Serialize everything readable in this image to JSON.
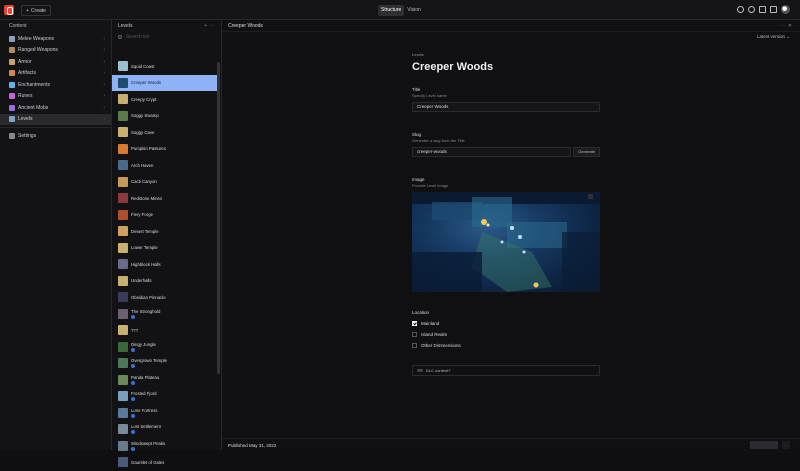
{
  "topbar": {
    "create_label": "Create",
    "tabs": [
      "Structure",
      "Vision"
    ],
    "active_tab": 0
  },
  "nav": {
    "title": "Content",
    "items": [
      {
        "label": "Melee Weapons",
        "icon": "sword-icon",
        "color": "#8fa0b3"
      },
      {
        "label": "Ranged Weapons",
        "icon": "bow-icon",
        "color": "#b38b5a"
      },
      {
        "label": "Armor",
        "icon": "armor-icon",
        "color": "#c9a36b"
      },
      {
        "label": "Artifacts",
        "icon": "artifact-icon",
        "color": "#d88a3a"
      },
      {
        "label": "Enchantments",
        "icon": "enchantment-icon",
        "color": "#5fb3e6"
      },
      {
        "label": "Runes",
        "icon": "rune-icon",
        "color": "#c85fd6"
      },
      {
        "label": "Ancient Mobs",
        "icon": "mob-icon",
        "color": "#9b6be0"
      },
      {
        "label": "Levels",
        "icon": "map-icon",
        "color": "#7fa5c4"
      }
    ],
    "settings_label": "Settings"
  },
  "levels": {
    "title": "Levels",
    "search_placeholder": "Search list",
    "items": [
      {
        "label": "Squid Coast",
        "color": "#9bbfd0",
        "dlc": false
      },
      {
        "label": "Creeper Woods",
        "color": "#1e4a6e",
        "dlc": false
      },
      {
        "label": "Creepy Crypt",
        "color": "#c8b070",
        "dlc": false
      },
      {
        "label": "Soggy Swamp",
        "color": "#5a7a4a",
        "dlc": false
      },
      {
        "label": "Soggy Cave",
        "color": "#c8b070",
        "dlc": false
      },
      {
        "label": "Pumpkin Pastures",
        "color": "#d87a30",
        "dlc": false
      },
      {
        "label": "Arch Haven",
        "color": "#4a6a8a",
        "dlc": false
      },
      {
        "label": "Cacti Canyon",
        "color": "#c89a5a",
        "dlc": false
      },
      {
        "label": "Redstone Mines",
        "color": "#8a3a3a",
        "dlc": false
      },
      {
        "label": "Fiery Forge",
        "color": "#b0502a",
        "dlc": false
      },
      {
        "label": "Desert Temple",
        "color": "#d0a060",
        "dlc": false
      },
      {
        "label": "Lower Temple",
        "color": "#c8b070",
        "dlc": false
      },
      {
        "label": "Highblock Halls",
        "color": "#6a6a8a",
        "dlc": false
      },
      {
        "label": "Underhalls",
        "color": "#c8b070",
        "dlc": false
      },
      {
        "label": "Obsidian Pinnacle",
        "color": "#3a3a5a",
        "dlc": false
      },
      {
        "label": "The Stronghold",
        "color": "#6a6070",
        "dlc": true
      },
      {
        "label": "???",
        "color": "#c8b070",
        "dlc": false
      },
      {
        "label": "Dingy Jungle",
        "color": "#3a6a3a",
        "dlc": true
      },
      {
        "label": "Overgrown Temple",
        "color": "#4a7a5a",
        "dlc": true
      },
      {
        "label": "Panda Plateau",
        "color": "#6a8a5a",
        "dlc": true
      },
      {
        "label": "Frosted Fjord",
        "color": "#7aa0c0",
        "dlc": true
      },
      {
        "label": "Lone Fortress",
        "color": "#5a7a9a",
        "dlc": true
      },
      {
        "label": "Lost Settlement",
        "color": "#7a8a9a",
        "dlc": true
      },
      {
        "label": "Windswept Peaks",
        "color": "#6a7a8a",
        "dlc": true
      },
      {
        "label": "Gauntlet of Gales",
        "color": "#4a5a7a",
        "dlc": false
      }
    ]
  },
  "doc": {
    "header_title": "Creeper Woods",
    "version_label": "Latest version",
    "kicker": "Levels",
    "title": "Creeper Woods",
    "title_field": {
      "label": "Title",
      "desc": "Specify Level name",
      "value": "Creeper Woods"
    },
    "slug_field": {
      "label": "Slug",
      "desc": "Generate a slug from the Title",
      "value": "creeper-woods",
      "button": "Generate"
    },
    "image_field": {
      "label": "Image",
      "desc": "Provide Level image"
    },
    "location": {
      "label": "Location",
      "options": [
        {
          "label": "Mainland",
          "checked": true
        },
        {
          "label": "Island Realm",
          "checked": false
        },
        {
          "label": "Other Dimmensions",
          "checked": false
        }
      ]
    },
    "dlc_label": "DLC content?",
    "published": "Published May 31, 2022"
  }
}
